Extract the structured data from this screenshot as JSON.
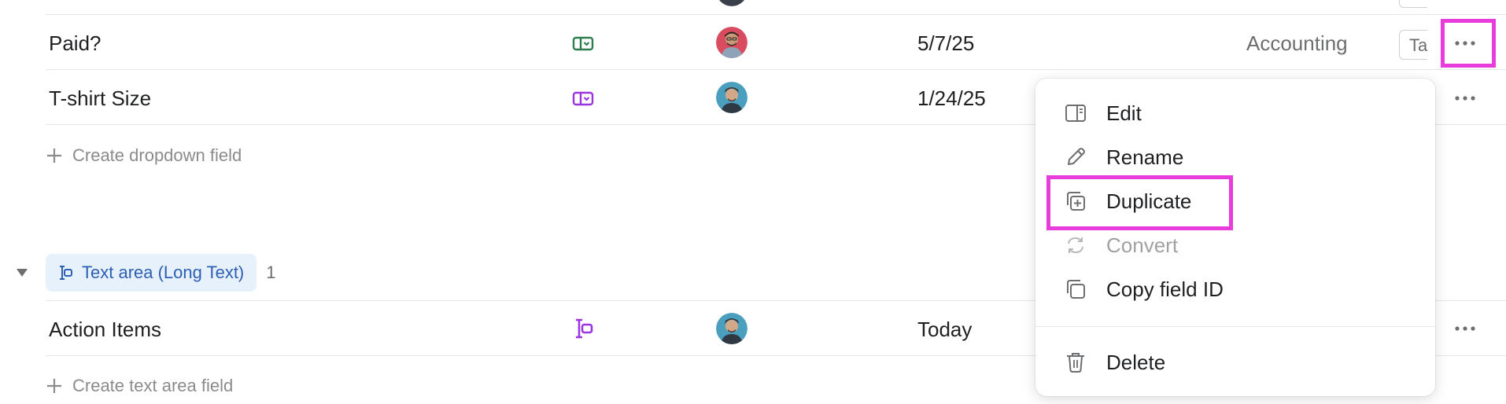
{
  "rows": [
    {
      "name": "Paid?",
      "date": "5/7/25",
      "team": "Accounting",
      "tag_stub": "Ta",
      "type_icon": "dropdown-field-icon",
      "type_color": "#2e7d4f"
    },
    {
      "name": "T-shirt Size",
      "date": "1/24/25",
      "type_icon": "dropdown-field-icon",
      "type_color": "#9b35e0"
    },
    {
      "name": "Action Items",
      "date": "Today",
      "type_icon": "text-area-field-icon",
      "type_color": "#9b35e0"
    }
  ],
  "create_dropdown": "Create dropdown field",
  "create_text_area": "Create text area field",
  "section": {
    "label": "Text area (Long Text)",
    "count": "1"
  },
  "menu": {
    "items": [
      {
        "label": "Edit",
        "icon": "panel-icon",
        "enabled": true
      },
      {
        "label": "Rename",
        "icon": "pencil-icon",
        "enabled": true
      },
      {
        "label": "Duplicate",
        "icon": "duplicate-icon",
        "enabled": true
      },
      {
        "label": "Convert",
        "icon": "convert-icon",
        "enabled": false
      },
      {
        "label": "Copy field ID",
        "icon": "copy-icon",
        "enabled": true
      }
    ],
    "delete_label": "Delete"
  },
  "colors": {
    "highlight": "#e83cdb",
    "pill_bg": "#e7f1fb",
    "pill_text": "#2c5fb3"
  }
}
